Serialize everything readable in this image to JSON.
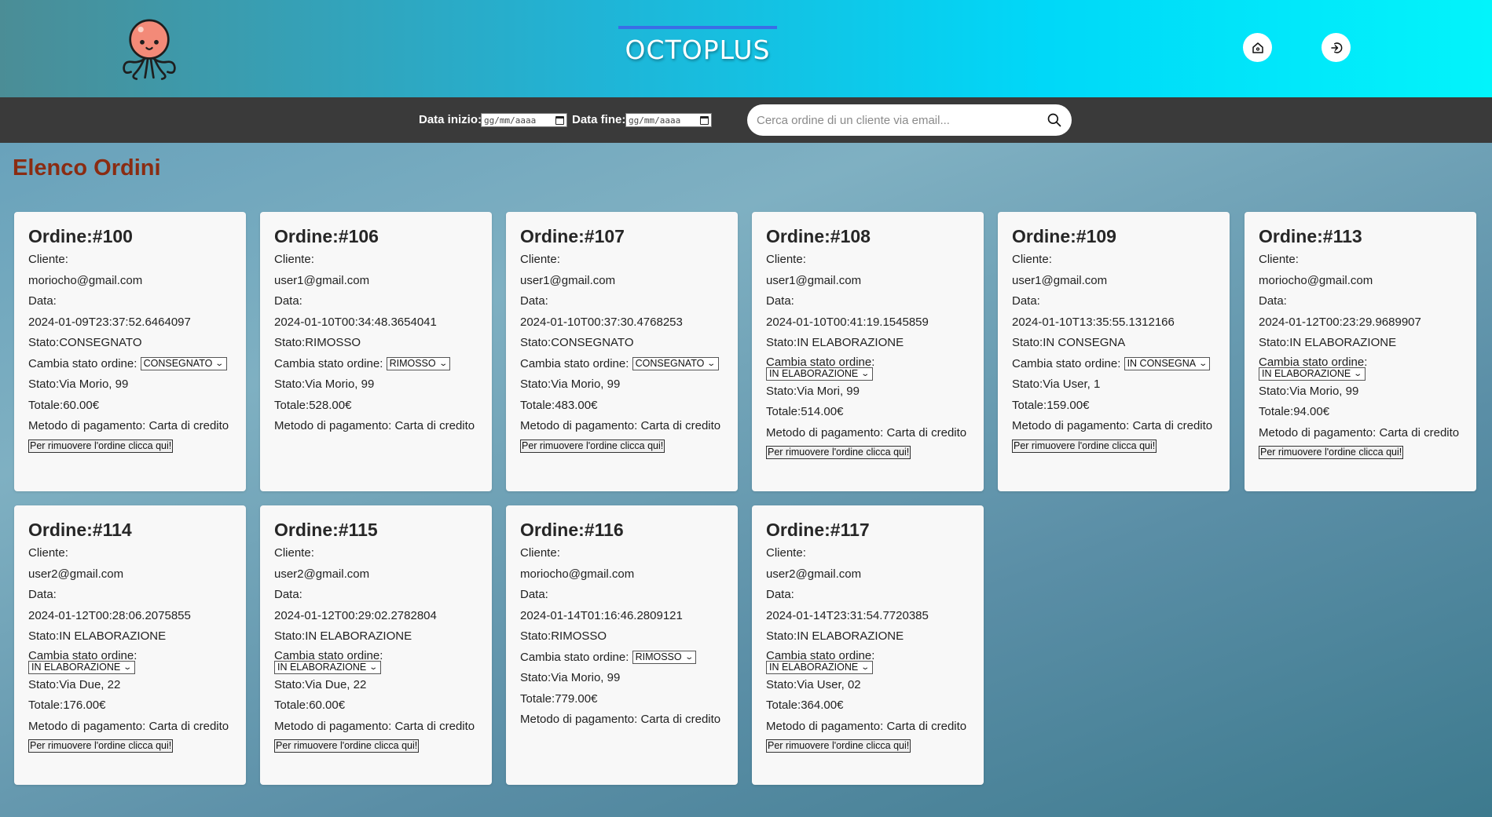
{
  "header": {
    "brand": "OCTOPLUS",
    "logo_icon": "octopus-logo-icon",
    "accent_color": "#3a6ee6",
    "buttons": [
      {
        "name": "home-button",
        "icon": "home-icon"
      },
      {
        "name": "logout-button",
        "icon": "logout-icon"
      }
    ]
  },
  "filters": {
    "start_label": "Data inizio:",
    "end_label": "Data fine:",
    "date_placeholder": "gg/mm/aaaa",
    "search_placeholder": "Cerca ordine di un cliente via email..."
  },
  "page": {
    "title": "Elenco Ordini"
  },
  "labels": {
    "order_prefix": "Ordine:",
    "client": "Cliente:",
    "date": "Data:",
    "state_prefix": "Stato:",
    "change_state": "Cambia stato ordine:",
    "total_prefix": "Totale:",
    "payment_prefix": "Metodo di pagamento: ",
    "remove": "Per rimuovere l'ordine clicca qui!"
  },
  "orders": [
    {
      "id": "#100",
      "email": "moriocho@gmail.com",
      "date": "2024-01-09T23:37:52.6464097",
      "status": "CONSEGNATO",
      "select": "CONSEGNATO",
      "address": "Via Morio, 99",
      "total": "60.00€",
      "payment": "Carta di credito",
      "removable": true,
      "select_wrap": false
    },
    {
      "id": "#106",
      "email": "user1@gmail.com",
      "date": "2024-01-10T00:34:48.3654041",
      "status": "RIMOSSO",
      "select": "RIMOSSO",
      "address": "Via Morio, 99",
      "total": "528.00€",
      "payment": "Carta di credito",
      "removable": false,
      "select_wrap": false
    },
    {
      "id": "#107",
      "email": "user1@gmail.com",
      "date": "2024-01-10T00:37:30.4768253",
      "status": "CONSEGNATO",
      "select": "CONSEGNATO",
      "address": "Via Morio, 99",
      "total": "483.00€",
      "payment": "Carta di credito",
      "removable": true,
      "select_wrap": false
    },
    {
      "id": "#108",
      "email": "user1@gmail.com",
      "date": "2024-01-10T00:41:19.1545859",
      "status": "IN ELABORAZIONE",
      "select": "IN ELABORAZIONE",
      "address": "Via Mori, 99",
      "total": "514.00€",
      "payment": "Carta di credito",
      "removable": true,
      "select_wrap": true
    },
    {
      "id": "#109",
      "email": "user1@gmail.com",
      "date": "2024-01-10T13:35:55.1312166",
      "status": "IN CONSEGNA",
      "select": "IN CONSEGNA",
      "address": "Via User, 1",
      "total": "159.00€",
      "payment": "Carta di credito",
      "removable": true,
      "select_wrap": false
    },
    {
      "id": "#113",
      "email": "moriocho@gmail.com",
      "date": "2024-01-12T00:23:29.9689907",
      "status": "IN ELABORAZIONE",
      "select": "IN ELABORAZIONE",
      "address": "Via Morio, 99",
      "total": "94.00€",
      "payment": "Carta di credito",
      "removable": true,
      "select_wrap": true
    },
    {
      "id": "#114",
      "email": "user2@gmail.com",
      "date": "2024-01-12T00:28:06.2075855",
      "status": "IN ELABORAZIONE",
      "select": "IN ELABORAZIONE",
      "address": "Via Due, 22",
      "total": "176.00€",
      "payment": "Carta di credito",
      "removable": true,
      "select_wrap": true
    },
    {
      "id": "#115",
      "email": "user2@gmail.com",
      "date": "2024-01-12T00:29:02.2782804",
      "status": "IN ELABORAZIONE",
      "select": "IN ELABORAZIONE",
      "address": "Via Due, 22",
      "total": "60.00€",
      "payment": "Carta di credito",
      "removable": true,
      "select_wrap": true
    },
    {
      "id": "#116",
      "email": "moriocho@gmail.com",
      "date": "2024-01-14T01:16:46.2809121",
      "status": "RIMOSSO",
      "select": "RIMOSSO",
      "address": "Via Morio, 99",
      "total": "779.00€",
      "payment": "Carta di credito",
      "removable": false,
      "select_wrap": false
    },
    {
      "id": "#117",
      "email": "user2@gmail.com",
      "date": "2024-01-14T23:31:54.7720385",
      "status": "IN ELABORAZIONE",
      "select": "IN ELABORAZIONE",
      "address": "Via User, 02",
      "total": "364.00€",
      "payment": "Carta di credito",
      "removable": true,
      "select_wrap": true
    }
  ]
}
